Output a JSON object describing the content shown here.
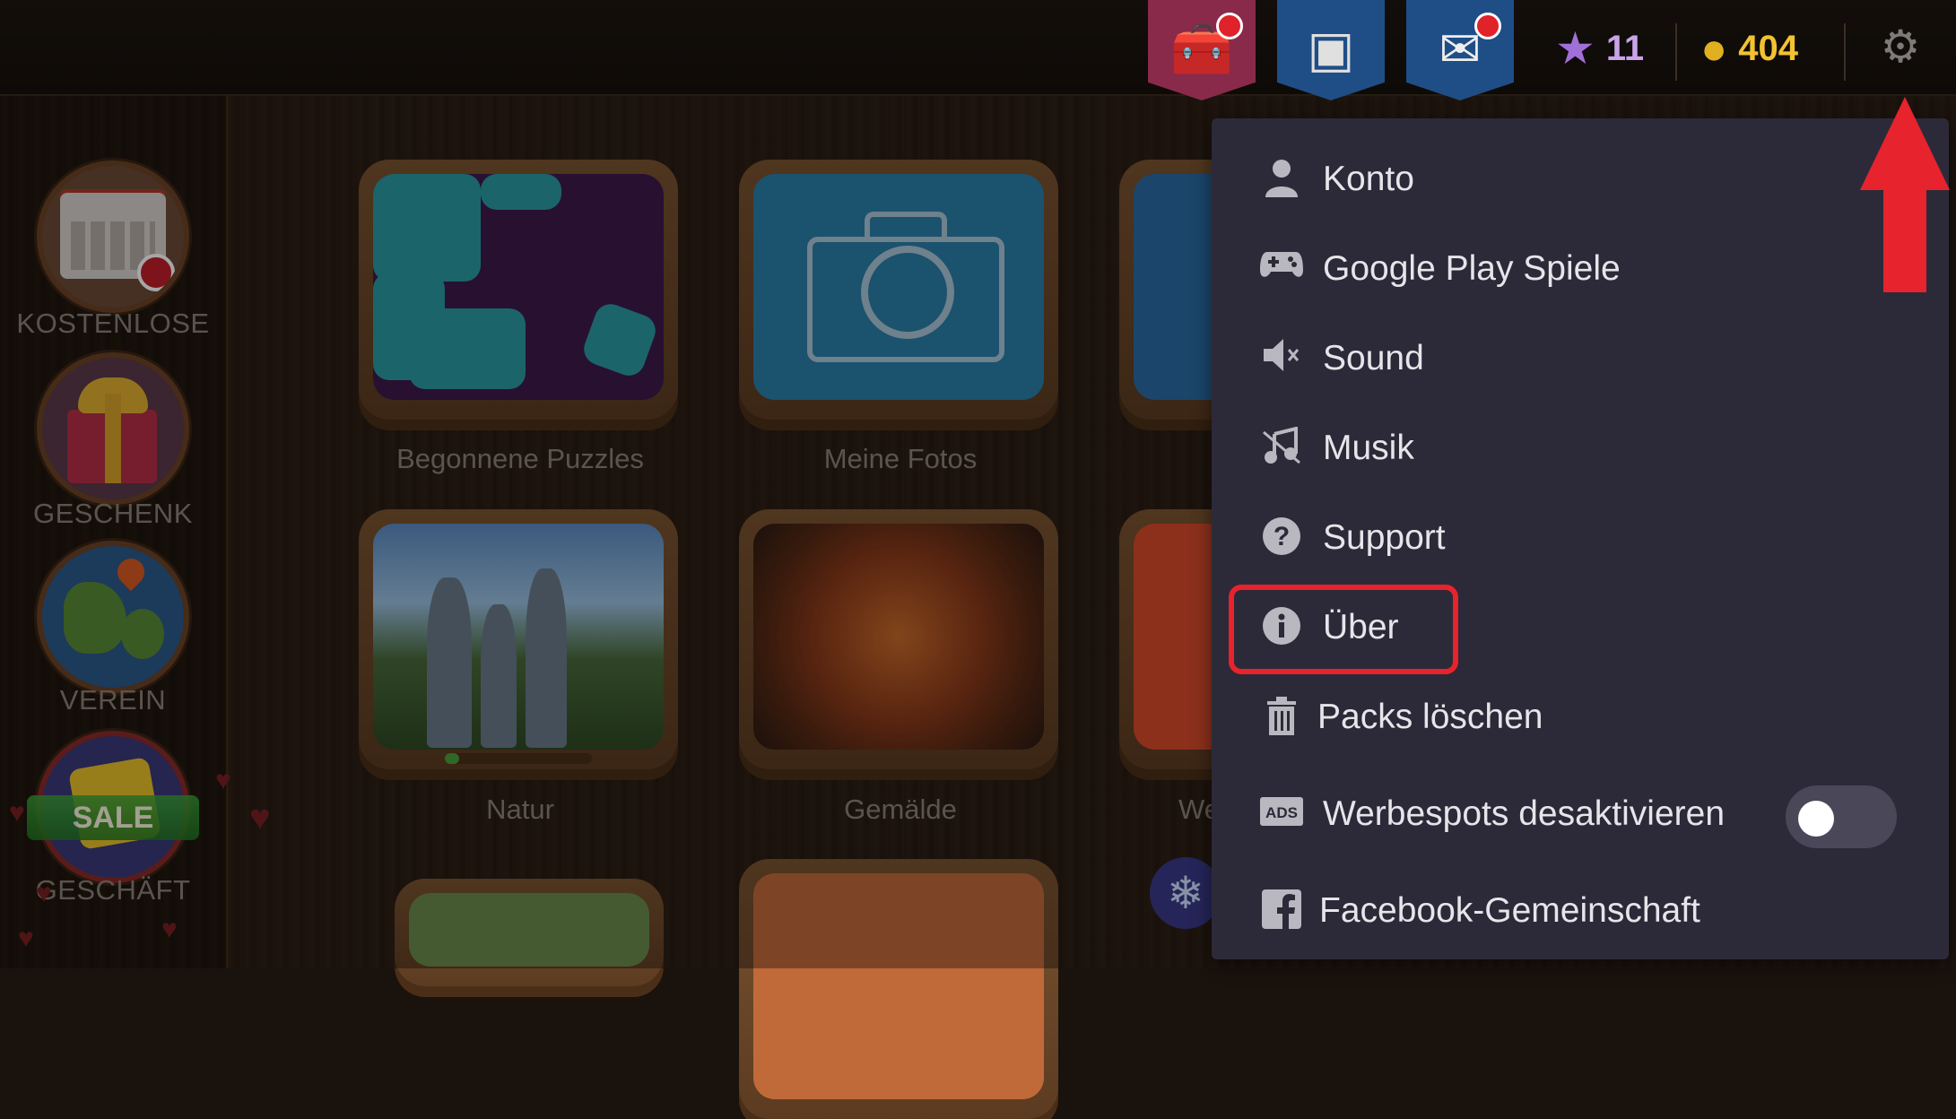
{
  "sidebar": {
    "items": [
      {
        "label": "KOSTENLOSE",
        "icon": "calendar-icon"
      },
      {
        "label": "GESCHENK",
        "icon": "gift-icon"
      },
      {
        "label": "VEREIN",
        "icon": "globe-icon"
      },
      {
        "label": "GESCHÄFT",
        "icon": "shop-puzzle-icon",
        "badge": "SALE"
      }
    ]
  },
  "tiles": [
    {
      "label": "Begonnene Puzzles"
    },
    {
      "label": "Meine Fotos"
    },
    {
      "label": "Natur",
      "progress": 0.1
    },
    {
      "label": "Gemälde"
    },
    {
      "label": "We"
    }
  ],
  "topbar": {
    "stars": "11",
    "coins": "404",
    "colors": {
      "stars": "#c9a5e8",
      "coins": "#f2c230"
    }
  },
  "menu": {
    "items": [
      {
        "label": "Konto",
        "icon": "person-icon"
      },
      {
        "label": "Google Play Spiele",
        "icon": "gamepad-icon"
      },
      {
        "label": "Sound",
        "icon": "speaker-muted-icon"
      },
      {
        "label": "Musik",
        "icon": "music-off-icon"
      },
      {
        "label": "Support",
        "icon": "help-icon"
      },
      {
        "label": "Über",
        "icon": "info-icon"
      },
      {
        "label": "Packs löschen",
        "icon": "trash-icon"
      },
      {
        "label": "Werbespots desaktivieren",
        "icon": "ads-icon",
        "toggle": false
      },
      {
        "label": "Facebook-Gemeinschaft",
        "icon": "facebook-icon"
      }
    ]
  },
  "annotation": {
    "highlight_color": "#e7232d"
  }
}
